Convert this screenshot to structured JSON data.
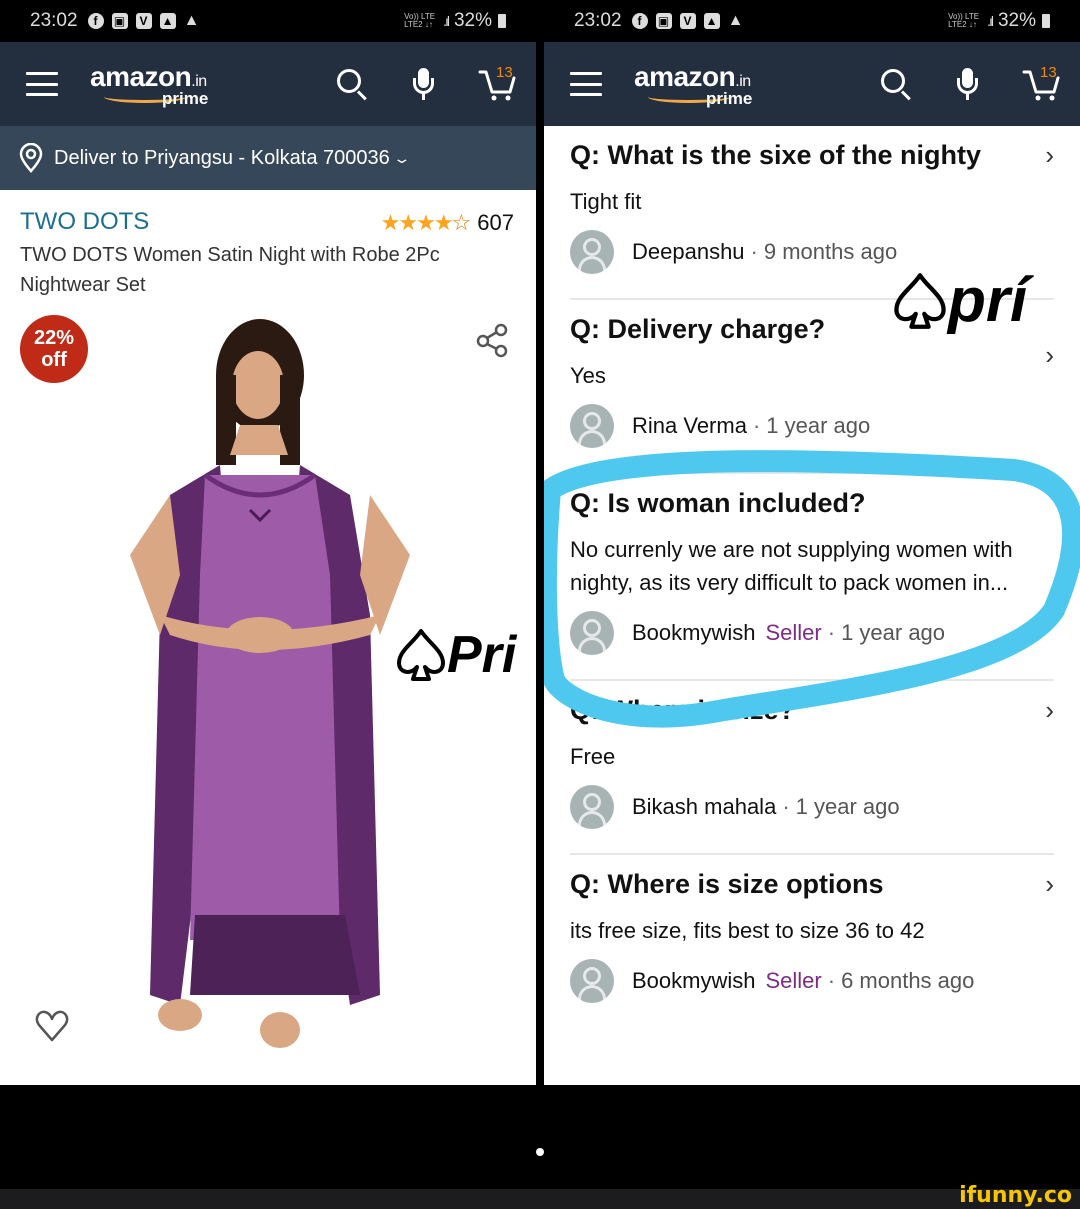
{
  "status_bar": {
    "time": "23:02",
    "notification_icons": [
      "facebook-icon",
      "storage-icon",
      "vivaldi-icon",
      "image-icon",
      "warning-icon"
    ],
    "network": "Vo)) LTE LTE2",
    "battery": "32%"
  },
  "header": {
    "logo_word": "amazon",
    "logo_tld": ".in",
    "logo_sub": "prime",
    "cart_count": "13"
  },
  "left": {
    "deliver_to": "Deliver to Priyangsu - Kolkata 700036",
    "brand": "TWO DOTS",
    "rating_stars": 4,
    "rating_max": 5,
    "rating_count": "607",
    "title": "TWO DOTS Women Satin Night with Robe 2Pc Nightwear Set",
    "discount_line1": "22%",
    "discount_line2": "off",
    "watermark": "Pri"
  },
  "right": {
    "watermark": "prí",
    "qa": [
      {
        "question": "Q: What is the sixe of the nighty",
        "answer": "Tight fit",
        "author": "Deepanshu",
        "seller": "",
        "when": "9 months ago"
      },
      {
        "question": "Q: Delivery charge?",
        "answer": "Yes",
        "author": "Rina Verma",
        "seller": "",
        "when": "1 year ago"
      },
      {
        "question": "Q: Is woman included?",
        "answer": "No currenly we are not supplying women with nighty, as its very difficult to pack women in...",
        "author": "Bookmywish",
        "seller": "Seller",
        "when": "1 year ago"
      },
      {
        "question": "Q: Where is size?",
        "answer": "Free",
        "author": "Bikash mahala",
        "seller": "",
        "when": "1 year ago"
      },
      {
        "question": "Q: Where is size options",
        "answer": "its free size, fits best to size 36 to 42",
        "author": "Bookmywish",
        "seller": "Seller",
        "when": "6 months ago"
      }
    ],
    "annotation_color": "#4fc8f0"
  },
  "footer": {
    "brand": "ifunny.co"
  },
  "colors": {
    "header_bg": "#232f3e",
    "deliver_bg": "#37475a",
    "brand_link": "#1b6e8f",
    "star": "#ffa41c",
    "badge": "#c02b18",
    "seller": "#7b2d84",
    "cart_count": "#f08804"
  }
}
